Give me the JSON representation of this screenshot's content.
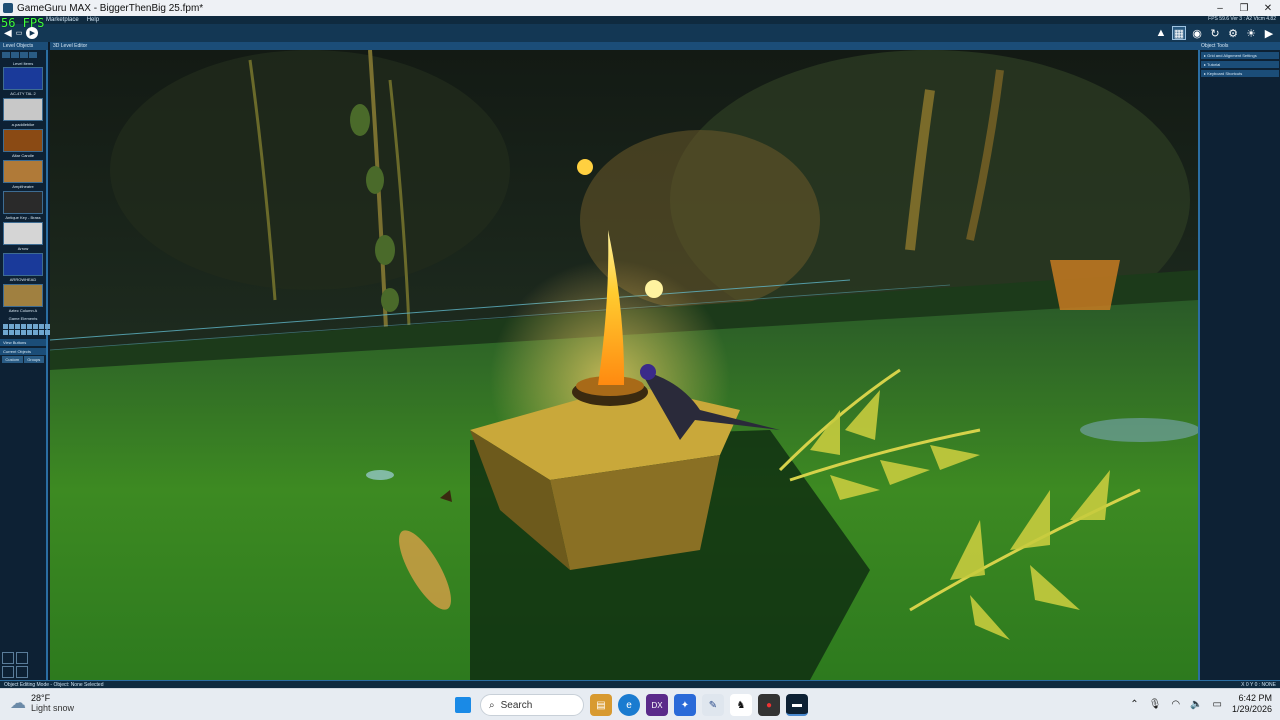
{
  "window": {
    "title": "GameGuru MAX - BiggerThenBig 25.fpm*",
    "controls": [
      "–",
      "❐",
      "✕"
    ]
  },
  "menu": [
    "Marketplace",
    "Help"
  ],
  "fps": "56 FPS",
  "version_text": "FPS 59.6 Ver 3 : A2 Vtcm 4.82",
  "toolbar_right_icons": [
    "terrain-icon",
    "map-icon",
    "globe-icon",
    "refresh-icon",
    "settings-icon",
    "light-icon",
    "camera-icon"
  ],
  "left_panel": {
    "header": "Level Objects",
    "subheader": "Level Items",
    "items": [
      {
        "name": "AC-4TY TAL 2",
        "color": "#1a3a9a"
      },
      {
        "name": "a.paddlebike",
        "color": "#c8c8c8"
      },
      {
        "name": "Altar Candle",
        "color": "#8a4a14"
      },
      {
        "name": "Ampitheatre",
        "color": "#b07a38"
      },
      {
        "name": "Antique Key - Brass",
        "color": "#2a2a2a"
      },
      {
        "name": "Arrow",
        "color": "#d5d5d5"
      },
      {
        "name": "ARROWHEAD",
        "color": "#1a3a9a"
      },
      {
        "name": "Aztec Column A",
        "color": "#a08040"
      }
    ],
    "game_elements_label": "Game Elements",
    "view_buttons_label": "View Buttons",
    "current_objects_label": "Current Objects",
    "bottom_tabs": [
      "Custom",
      "Groups"
    ]
  },
  "viewport": {
    "header": "3D Level Editor"
  },
  "right_panel": {
    "header": "Object Tools",
    "items": [
      "Grid and Alignment Settings",
      "Tutorial",
      "Keyboard Shortcuts"
    ]
  },
  "statusbar": {
    "left": "Object Editing Mode - Object: None Selected",
    "right": "X 0 Y 0 : NONE"
  },
  "taskbar": {
    "temp": "28°F",
    "condition": "Light snow",
    "search_label": "Search",
    "time": "6:42 PM",
    "date": "1/29/2026"
  }
}
